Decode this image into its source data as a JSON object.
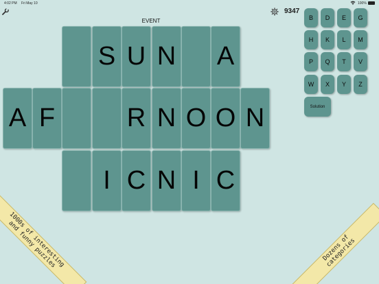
{
  "status_bar": {
    "time": "4:02 PM",
    "date": "Fri May 10",
    "battery": "100%"
  },
  "header": {
    "score": "9347",
    "puzzle_title": "EVENT"
  },
  "board": {
    "rows": [
      [
        "",
        "S",
        "U",
        "N",
        "",
        "A",
        ""
      ],
      [
        "A",
        "F",
        "",
        "",
        "R",
        "N",
        "O",
        "O",
        "N"
      ],
      [
        "",
        "I",
        "C",
        "N",
        "I",
        "C"
      ]
    ]
  },
  "keyboard": {
    "keys": [
      "B",
      "D",
      "E",
      "G",
      "H",
      "K",
      "L",
      "M",
      "P",
      "Q",
      "T",
      "V",
      "W",
      "X",
      "Y",
      "Z"
    ],
    "solution_label": "Solution"
  },
  "promo": {
    "left_line1": "1000s of interesting",
    "left_line2": "and funny puzzles",
    "right_line1": "Dozens of",
    "right_line2": "categories"
  },
  "icons": {
    "wrench": "wrench-icon",
    "gear": "gear-icon",
    "wifi": "wifi-icon",
    "battery": "battery-icon"
  }
}
